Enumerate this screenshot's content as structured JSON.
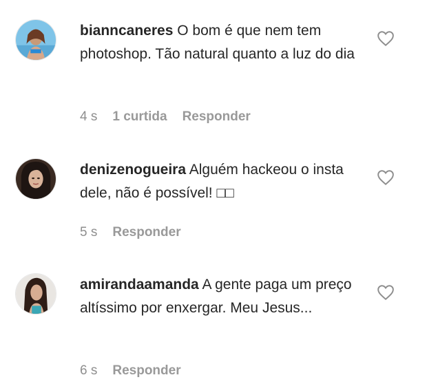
{
  "comments": [
    {
      "username": "bianncaneres",
      "text": "O bom é que nem tem photoshop. Tão natural quanto a luz do dia",
      "time": "4 s",
      "likes": "1 curtida",
      "reply": "Responder",
      "avatar_icon": "profile-photo"
    },
    {
      "username": "denizenogueira",
      "text": "Alguém hackeou o insta dele, não é possível! □□",
      "time": "5 s",
      "reply": "Responder",
      "avatar_icon": "profile-photo"
    },
    {
      "username": "amirandaamanda",
      "text": "A gente paga um preço altíssimo por enxergar. Meu Jesus...",
      "time": "6 s",
      "reply": "Responder",
      "avatar_icon": "profile-photo"
    }
  ],
  "icons": {
    "like": "heart-outline-icon"
  },
  "colors": {
    "text": "#262626",
    "meta": "#8e8e8e"
  }
}
